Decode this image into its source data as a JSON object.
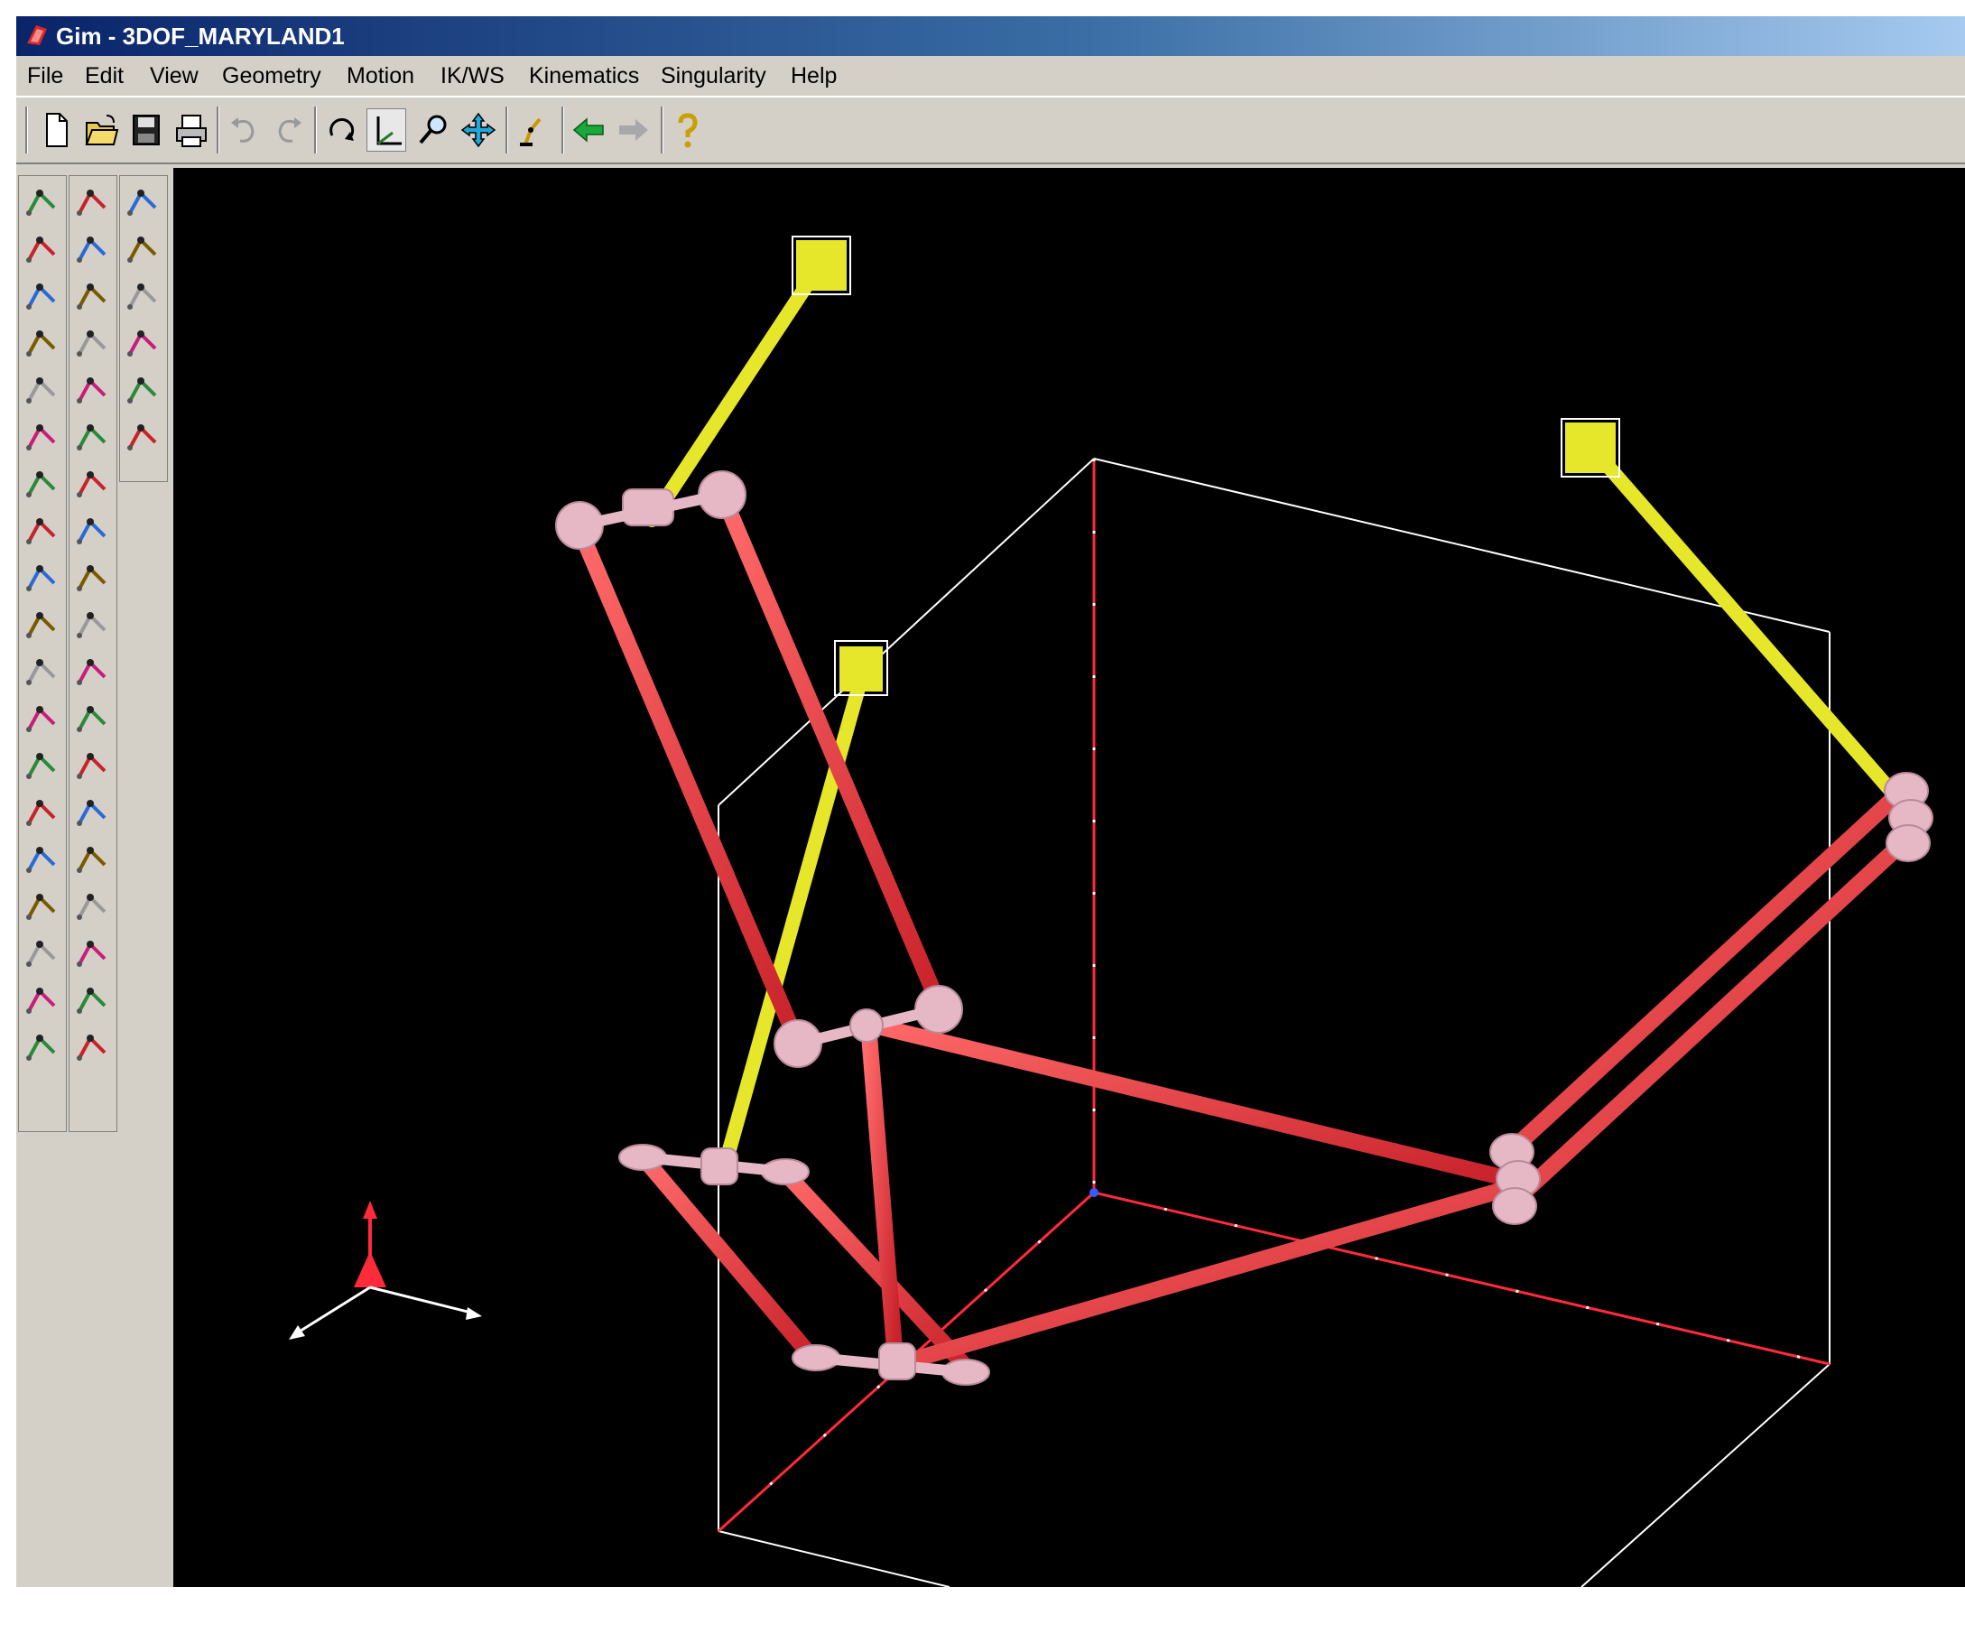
{
  "window": {
    "title": "Gim - 3DOF_MARYLAND1",
    "app_icon": "gim-logo-icon"
  },
  "menu": [
    "File",
    "Edit",
    "View",
    "Geometry",
    "Motion",
    "IK/WS",
    "Kinematics",
    "Singularity",
    "Help"
  ],
  "toolbar": {
    "buttons": [
      "new-file-icon",
      "open-folder-icon",
      "save-disk-icon",
      "print-icon",
      "undo-icon",
      "redo-icon",
      "rotate-view-icon",
      "axes-view-icon",
      "zoom-icon",
      "pan-icon",
      "robot-arm-icon",
      "back-arrow-icon",
      "forward-arrow-icon",
      "help-question-icon"
    ],
    "active": "axes-view-icon"
  },
  "palette": {
    "col1": [
      "link-tool-icon",
      "curve-tool-icon",
      "cross-joint-icon",
      "mechanism-box-icon",
      "point-tool-icon",
      "line-tool-icon",
      "plane-tool-icon",
      "polygon-tool-icon",
      "circle-tool-icon",
      "segment-tool-icon",
      "trajectory-pen-icon",
      "sphere-tool-icon",
      "surface-tool-icon",
      "path-tool-icon",
      "arrow-tool-icon",
      "intersect-tool-icon",
      "frame-tool-icon",
      "turn-tool-icon",
      "section-tool-icon"
    ],
    "col2": [
      "angle-tool-icon",
      "cube-joint-icon",
      "revolute-joint-icon",
      "prismatic-joint-icon",
      "actuator-icon",
      "spiral-joint-icon",
      "scissor-tool-icon",
      "analysis-tool-icon",
      "shell-tool-icon",
      "triangle-tool-icon",
      "sparkle-tool-icon",
      "first-frame-icon",
      "step-back-icon",
      "rewind-icon",
      "stop-sign-icon",
      "play-icon",
      "step-forward-icon",
      "pause-icon",
      "graph-tool-icon"
    ],
    "col3": [
      "workspace-icon",
      "twist-icon",
      "singularity-check-icon",
      "drop-tool-icon",
      "check-tool-icon",
      "arrow-link-icon"
    ]
  },
  "colors": {
    "viewport_bg": "#000000",
    "link_red": "#e8373b",
    "link_yellow": "#e6e62a",
    "joint_pink": "#e6b8c6",
    "wire": "#ffffff",
    "titlebar": "#0a246a"
  }
}
